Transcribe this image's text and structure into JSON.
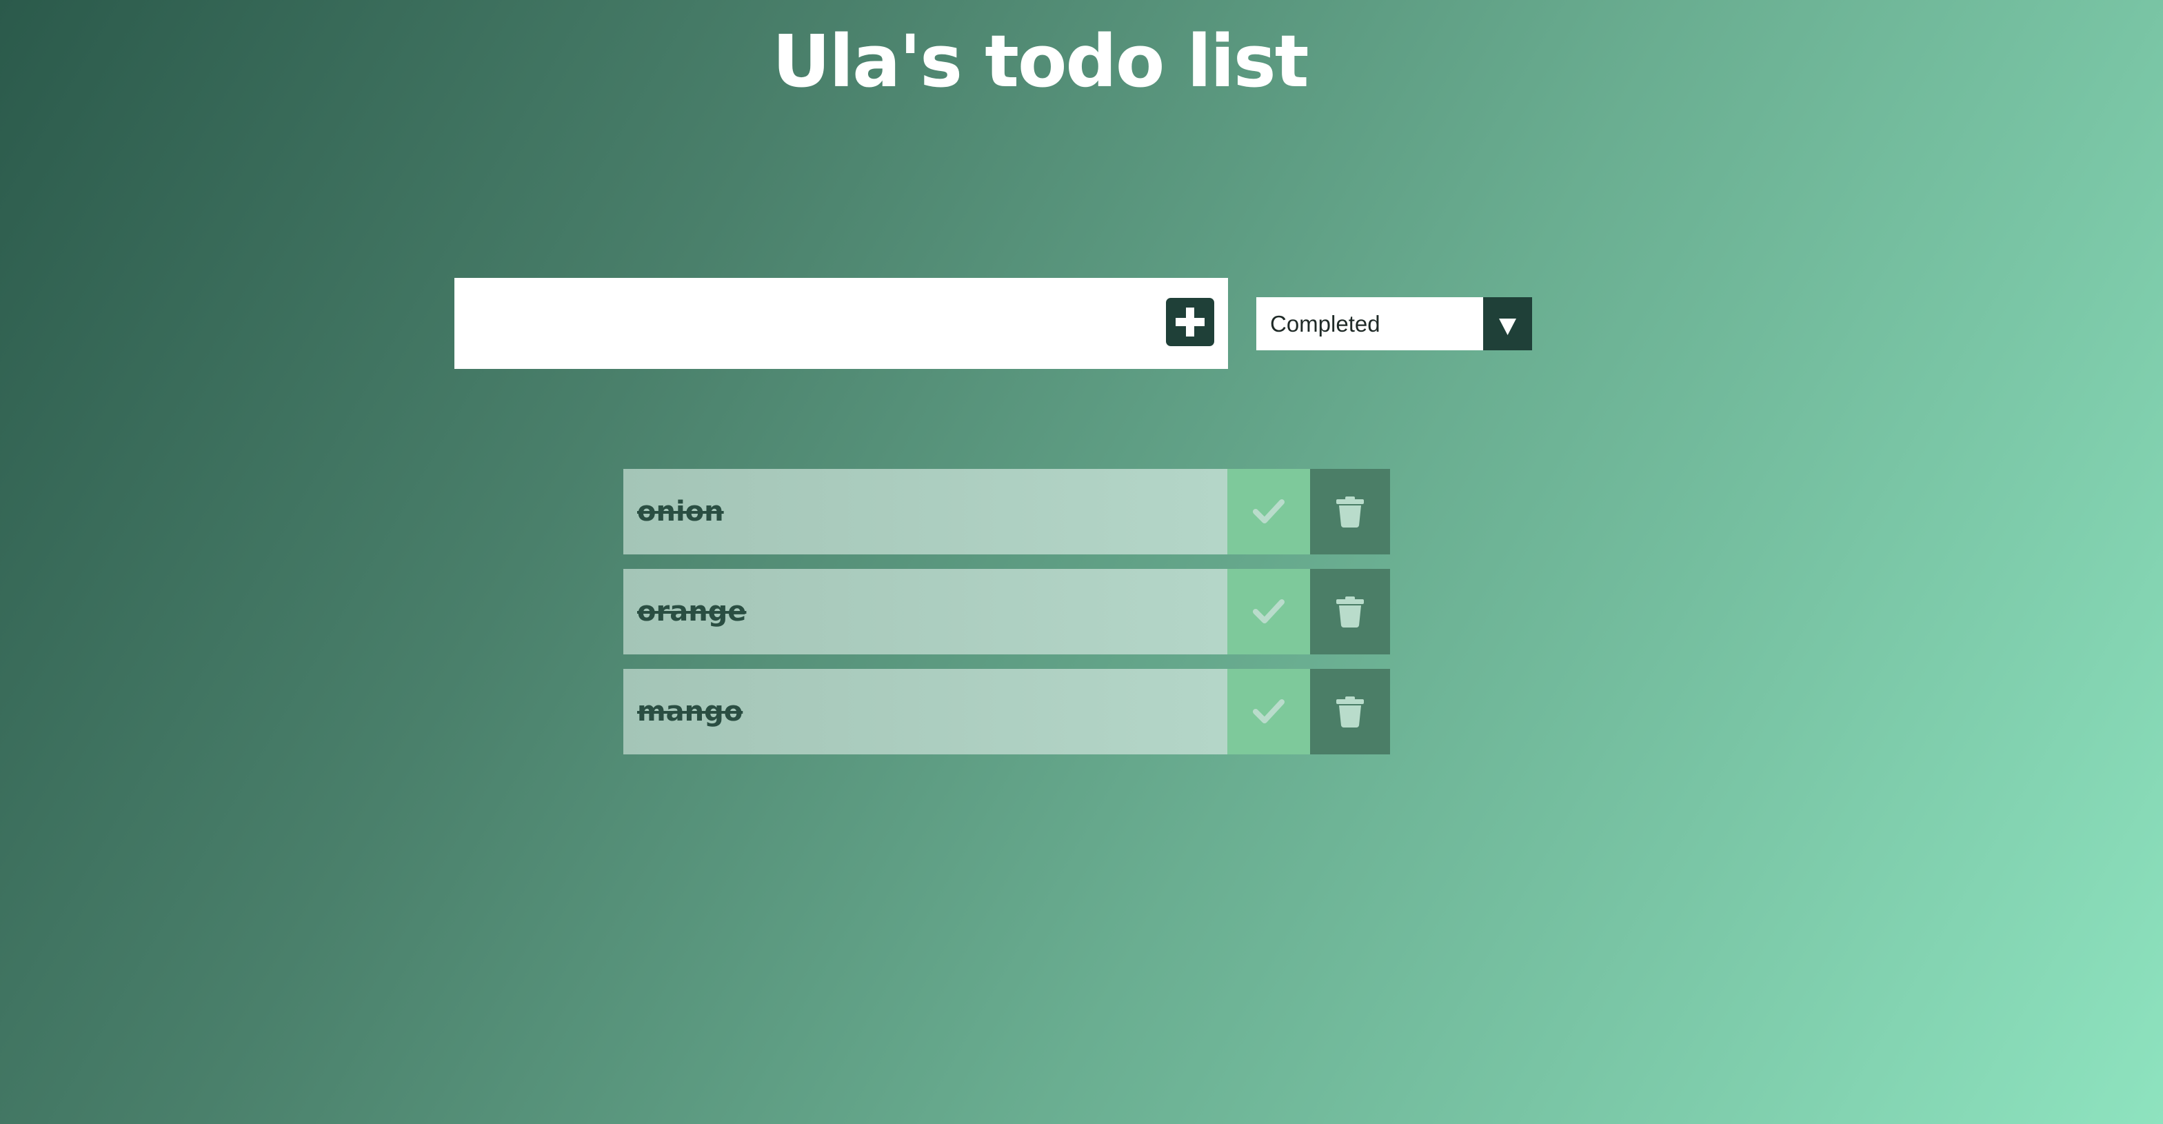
{
  "header": {
    "title": "Ula's todo list"
  },
  "form": {
    "input_value": "",
    "add_icon": "plus-icon",
    "filter": {
      "selected": "Completed",
      "arrow_icon": "triangle-down-icon"
    }
  },
  "todos": [
    {
      "text": "onion",
      "completed": true,
      "check_icon": "check-icon",
      "delete_icon": "trash-icon"
    },
    {
      "text": "orange",
      "completed": true,
      "check_icon": "check-icon",
      "delete_icon": "trash-icon"
    },
    {
      "text": "mango",
      "completed": true,
      "check_icon": "check-icon",
      "delete_icon": "trash-icon"
    }
  ],
  "colors": {
    "dark_accent": "#1f4038",
    "complete_button": "#7ec99b",
    "trash_button": "#4b7e67",
    "item_background": "#a4c5b7",
    "text_dark": "#2a4e42"
  }
}
